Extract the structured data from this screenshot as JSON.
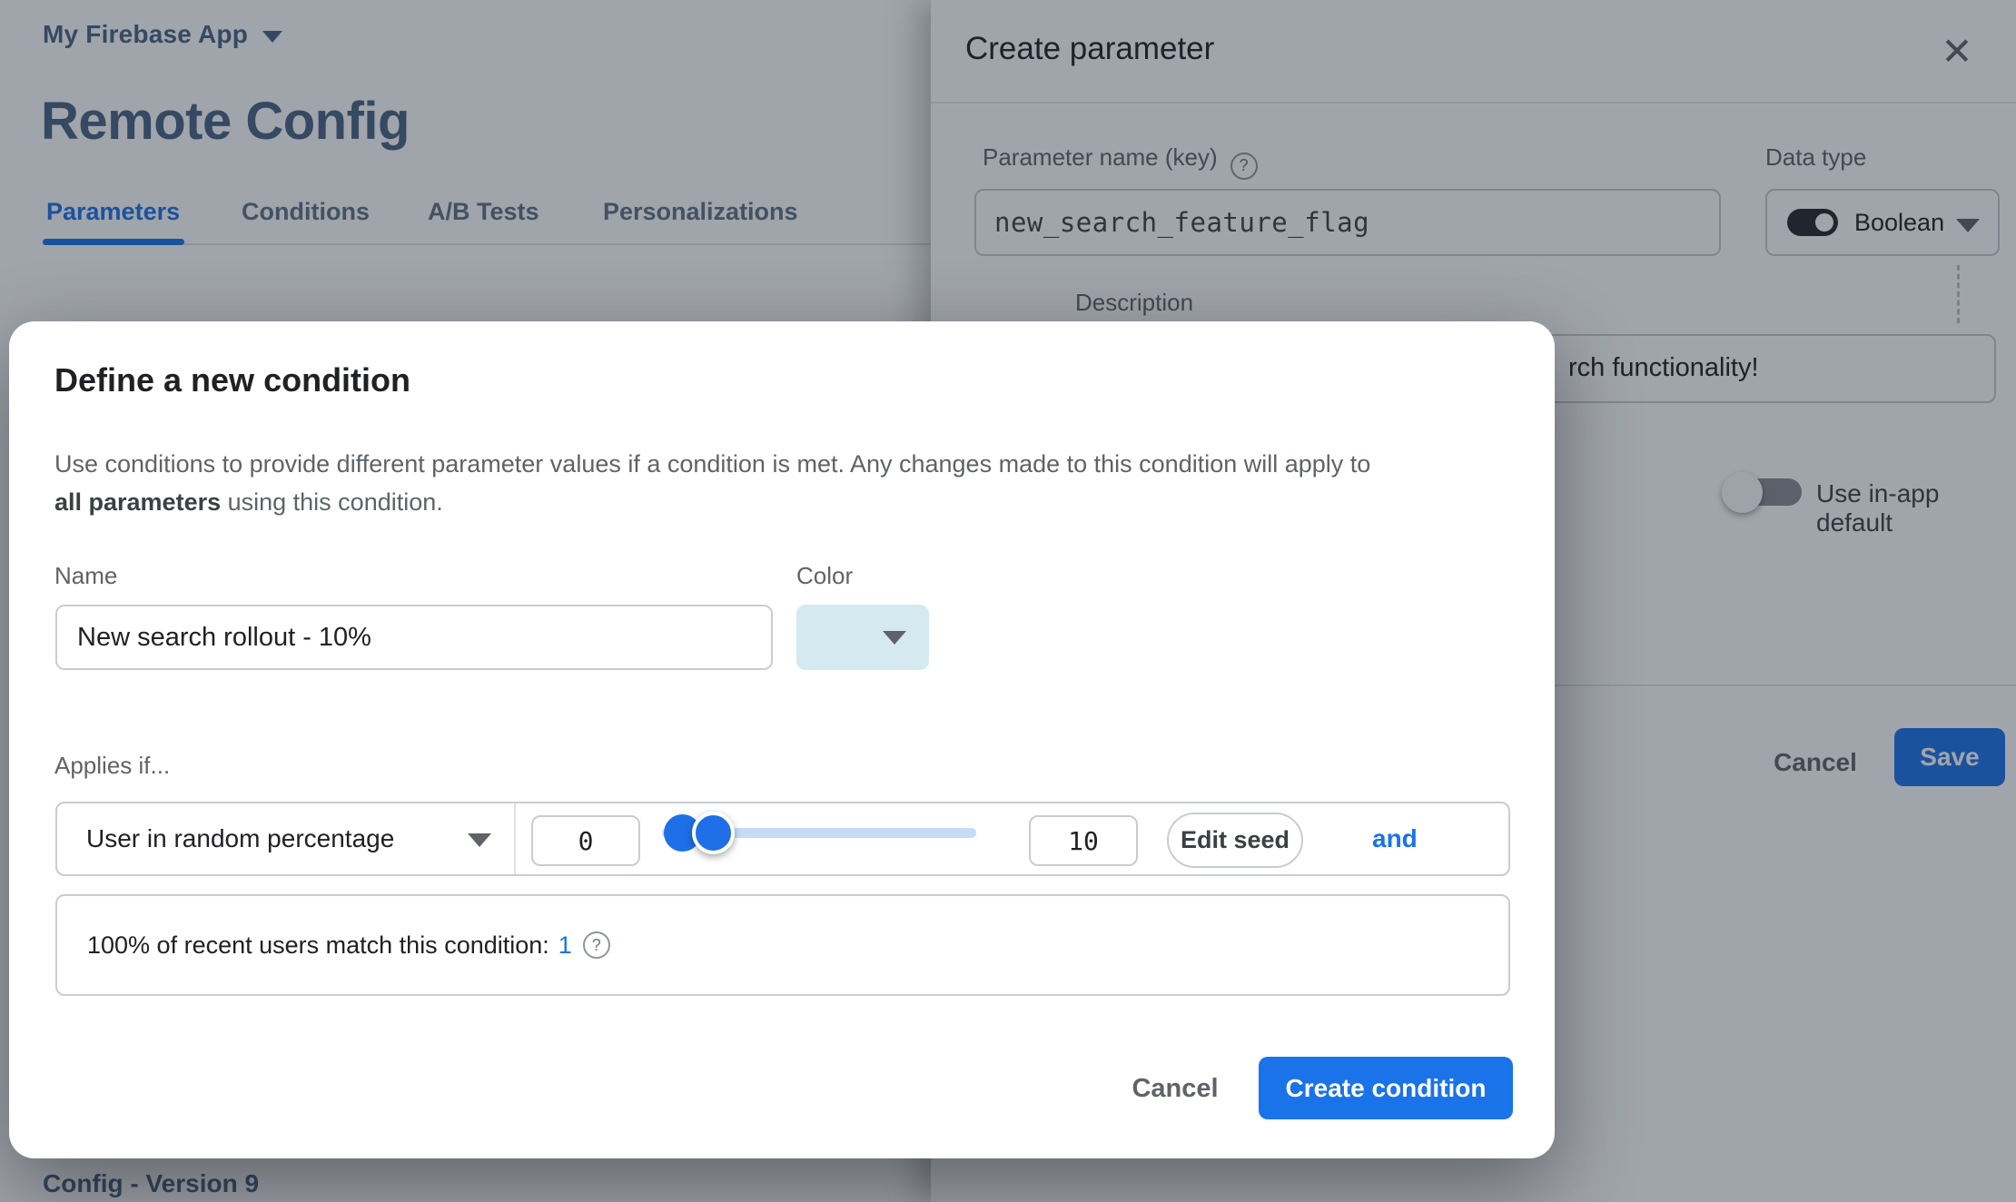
{
  "colors": {
    "accent_blue": "#1a73e8",
    "page_heading_slate": "#476282",
    "color_swatch_teal": "#d5e9f0",
    "slider_track_blue": "#c7dbf9",
    "border_gray": "#c9ccd0",
    "text_dark": "#202124",
    "text_gray": "#5f6368"
  },
  "icons": {
    "close": "✕",
    "help": "?"
  },
  "page": {
    "app_name": "My Firebase App",
    "title": "Remote Config",
    "tabs": [
      {
        "label": "Parameters",
        "active": true
      },
      {
        "label": "Conditions",
        "active": false
      },
      {
        "label": "A/B Tests",
        "active": false
      },
      {
        "label": "Personalizations",
        "active": false
      }
    ],
    "version_text": "Config - Version 9"
  },
  "panel": {
    "title": "Create parameter",
    "param_label": "Parameter name (key)",
    "param_value": "new_search_feature_flag",
    "datatype_label": "Data type",
    "datatype_value": "Boolean",
    "description_label": "Description",
    "description_value_visible": "rch functionality!",
    "default_toggle_label": "Use in-app default",
    "cancel_label": "Cancel",
    "save_label": "Save"
  },
  "modal": {
    "title": "Define a new condition",
    "body_line1": "Use conditions to provide different parameter values if a condition is met. Any changes made to this condition will apply to",
    "body_bold": "all parameters",
    "body_rest": " using this condition.",
    "name_label": "Name",
    "name_value": "New search rollout - 10%",
    "color_label": "Color",
    "applies_label": "Applies if...",
    "condition": {
      "type": "User in random percentage",
      "min": "0",
      "max": "10",
      "edit_seed_label": "Edit seed",
      "and_label": "and"
    },
    "match_text": "100% of recent users match this condition:",
    "match_value": "1",
    "cancel_label": "Cancel",
    "create_label": "Create condition"
  }
}
